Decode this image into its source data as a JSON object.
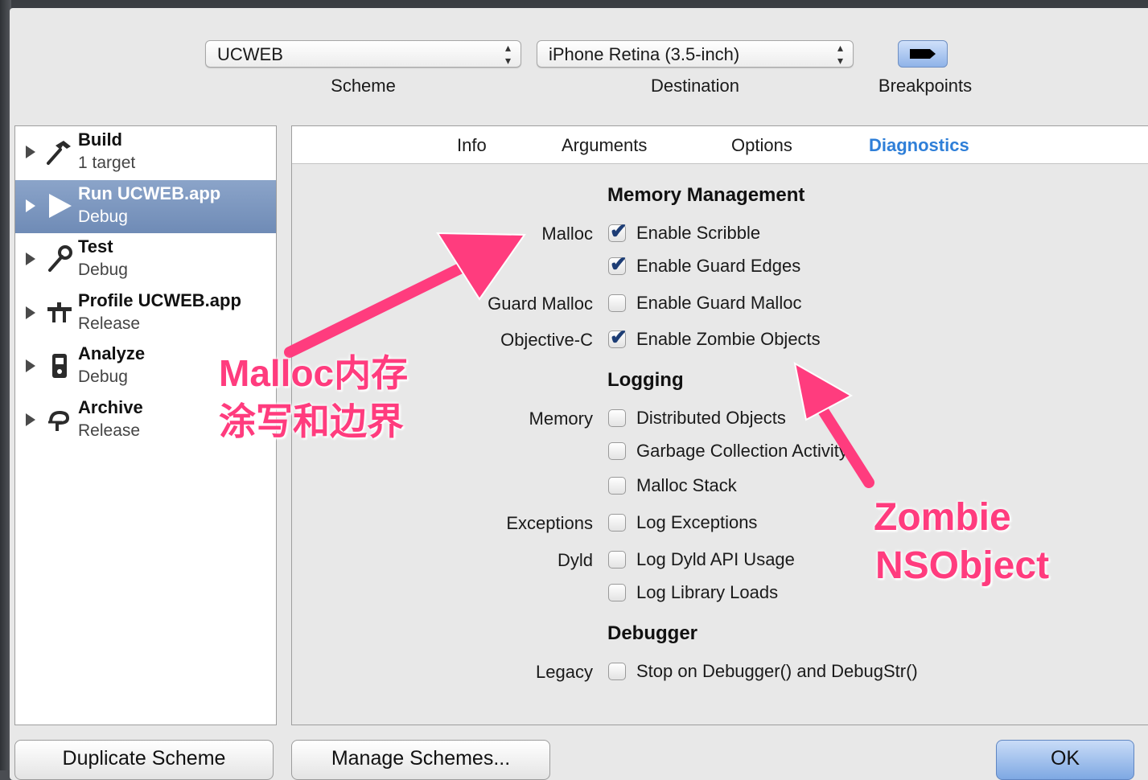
{
  "toolbar": {
    "scheme_value": "UCWEB",
    "scheme_label": "Scheme",
    "destination_value": "iPhone Retina (3.5-inch)",
    "destination_label": "Destination",
    "breakpoints_label": "Breakpoints"
  },
  "actions": [
    {
      "name": "Build",
      "sub": "1 target",
      "icon": "hammer-icon",
      "glyph": "🔨"
    },
    {
      "name": "Run UCWEB.app",
      "sub": "Debug",
      "icon": "play-icon",
      "glyph": "▶"
    },
    {
      "name": "Test",
      "sub": "Debug",
      "icon": "wrench-icon",
      "glyph": "🔧"
    },
    {
      "name": "Profile UCWEB.app",
      "sub": "Release",
      "icon": "profile-icon",
      "glyph": "╤"
    },
    {
      "name": "Analyze",
      "sub": "Debug",
      "icon": "analyze-icon",
      "glyph": "▣"
    },
    {
      "name": "Archive",
      "sub": "Release",
      "icon": "archive-icon",
      "glyph": "ቦ"
    }
  ],
  "tabs": [
    "Info",
    "Arguments",
    "Options",
    "Diagnostics"
  ],
  "active_tab": "Diagnostics",
  "diagnostics": {
    "memory_management": {
      "title": "Memory Management",
      "rows": [
        {
          "label": "Malloc",
          "option": "Enable Scribble",
          "checked": true
        },
        {
          "label": "",
          "option": "Enable Guard Edges",
          "checked": true
        },
        {
          "label": "Guard Malloc",
          "option": "Enable Guard Malloc",
          "checked": false
        },
        {
          "label": "Objective-C",
          "option": "Enable Zombie Objects",
          "checked": true
        }
      ]
    },
    "logging": {
      "title": "Logging",
      "rows": [
        {
          "label": "Memory",
          "option": "Distributed Objects",
          "checked": false
        },
        {
          "label": "",
          "option": "Garbage Collection Activity",
          "checked": false
        },
        {
          "label": "",
          "option": "Malloc Stack",
          "checked": false
        },
        {
          "label": "Exceptions",
          "option": "Log Exceptions",
          "checked": false
        },
        {
          "label": "Dyld",
          "option": "Log Dyld API Usage",
          "checked": false
        },
        {
          "label": "",
          "option": "Log Library Loads",
          "checked": false
        }
      ]
    },
    "debugger": {
      "title": "Debugger",
      "rows": [
        {
          "label": "Legacy",
          "option": "Stop on Debugger() and DebugStr()",
          "checked": false
        }
      ]
    }
  },
  "buttons": {
    "duplicate": "Duplicate Scheme",
    "manage": "Manage Schemes...",
    "ok": "OK"
  },
  "annotations": {
    "malloc_note_line1": "Malloc内存",
    "malloc_note_line2": "涂写和边界",
    "zombie_note_line1": "Zombie",
    "zombie_note_line2": "NSObject",
    "color": "#ff3c7e"
  }
}
